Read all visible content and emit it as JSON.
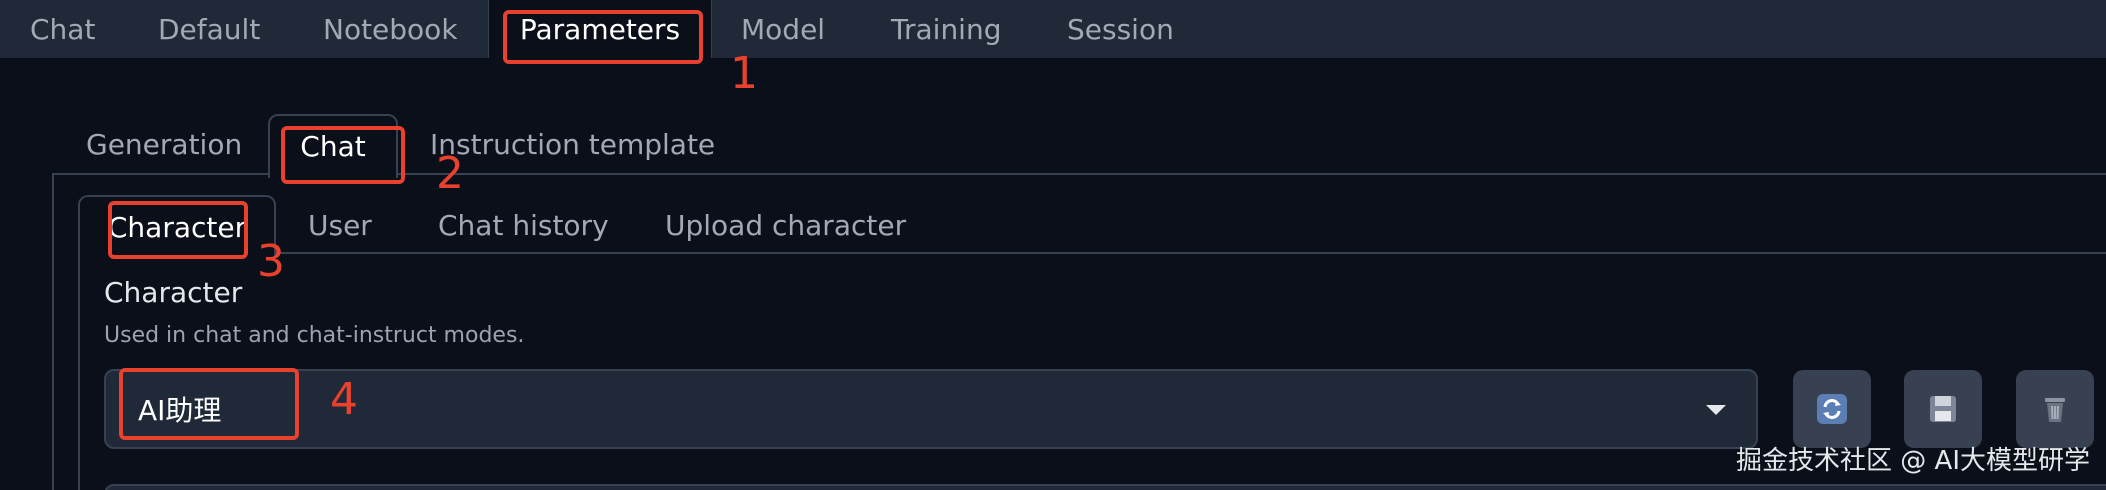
{
  "top_tabs": [
    "Chat",
    "Default",
    "Notebook",
    "Parameters",
    "Model",
    "Training",
    "Session"
  ],
  "param_tabs": [
    "Generation",
    "Chat",
    "Instruction template"
  ],
  "chat_tabs": [
    "Character",
    "User",
    "Chat history",
    "Upload character"
  ],
  "character": {
    "title": "Character",
    "description": "Used in chat and chat-instruct modes.",
    "selected": "AI助理"
  },
  "buttons": [
    "refresh-icon",
    "save-icon",
    "delete-icon"
  ],
  "annotations": [
    "1",
    "2",
    "3",
    "4"
  ],
  "annotation_color": "#e8412e",
  "watermark": "掘金技术社区 @ AI大模型研学"
}
